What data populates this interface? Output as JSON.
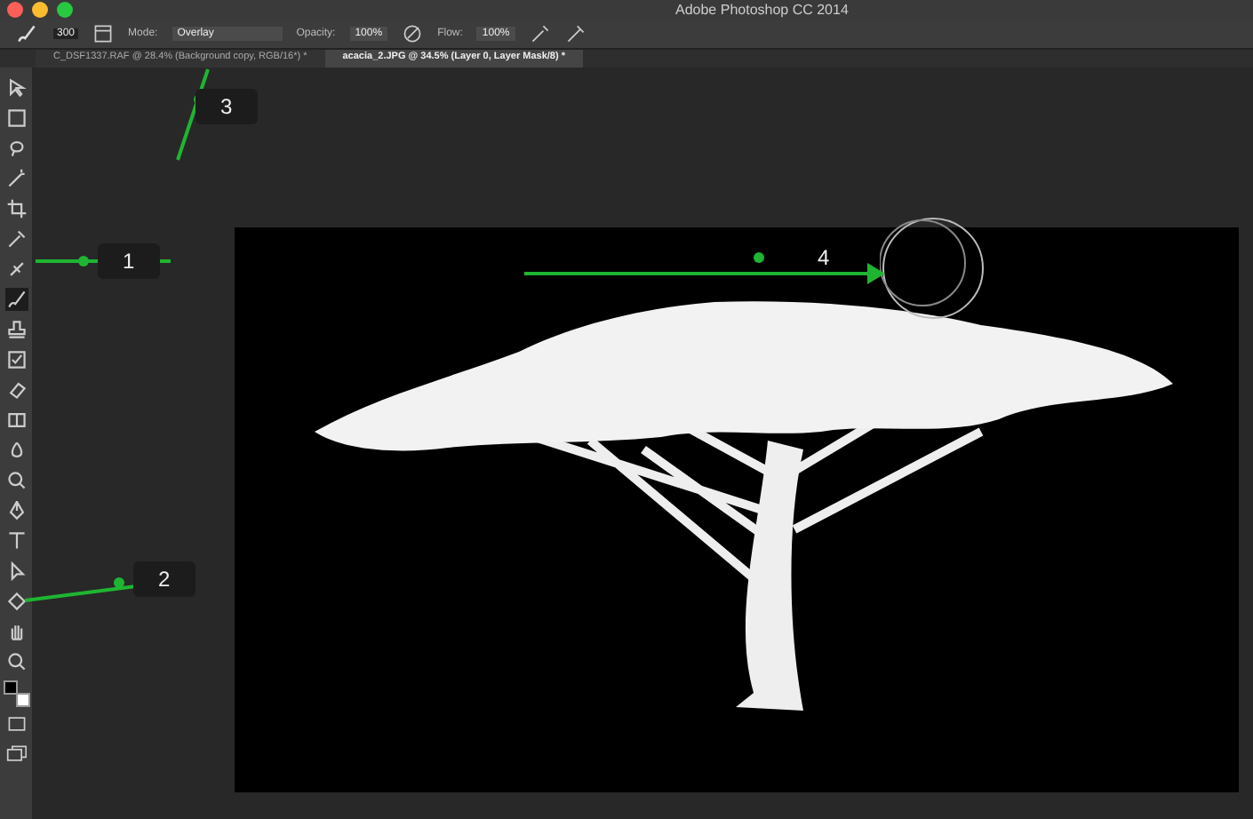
{
  "window": {
    "title": "Adobe Photoshop CC 2014"
  },
  "options_bar": {
    "brush_size": "300",
    "mode_label": "Mode:",
    "mode": "Overlay",
    "opacity_label": "Opacity:",
    "opacity": "100%",
    "flow_label": "Flow:",
    "flow": "100%"
  },
  "tabs": [
    {
      "label": "C_DSF1337.RAF @ 28.4% (Background copy, RGB/16*) *",
      "selected": false
    },
    {
      "label": "acacia_2.JPG @ 34.5% (Layer 0, Layer Mask/8) *",
      "selected": true
    }
  ],
  "tools": [
    {
      "kind": "move",
      "selected": false
    },
    {
      "kind": "marquee",
      "selected": false
    },
    {
      "kind": "lasso",
      "selected": false
    },
    {
      "kind": "wand",
      "selected": false
    },
    {
      "kind": "crop",
      "selected": false
    },
    {
      "kind": "eyedropper",
      "selected": false
    },
    {
      "kind": "bandage",
      "selected": false
    },
    {
      "kind": "brush",
      "selected": true
    },
    {
      "kind": "stamp",
      "selected": false
    },
    {
      "kind": "history",
      "selected": false
    },
    {
      "kind": "eraser",
      "selected": false
    },
    {
      "kind": "gradient",
      "selected": false
    },
    {
      "kind": "blur",
      "selected": false
    },
    {
      "kind": "dodge",
      "selected": false
    },
    {
      "kind": "pen",
      "selected": false
    },
    {
      "kind": "type",
      "selected": false
    },
    {
      "kind": "select",
      "selected": false
    },
    {
      "kind": "shape",
      "selected": false
    },
    {
      "kind": "hand",
      "selected": false
    },
    {
      "kind": "zoom",
      "selected": false
    }
  ],
  "callouts": [
    {
      "label": "1",
      "kind": "boxed"
    },
    {
      "label": "2",
      "kind": "boxed"
    },
    {
      "label": "3",
      "kind": "boxed"
    },
    {
      "label": "4",
      "kind": "plain"
    }
  ]
}
